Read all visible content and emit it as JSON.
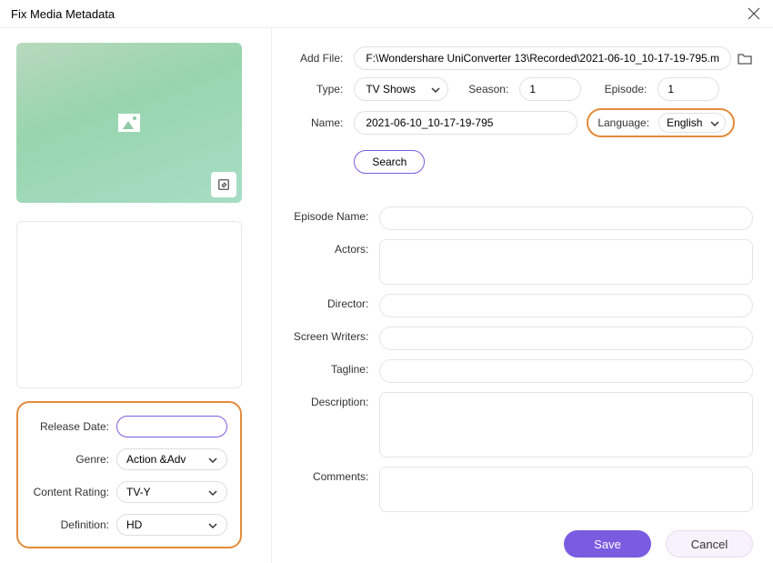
{
  "titlebar": {
    "title": "Fix Media Metadata"
  },
  "top": {
    "add_file_label": "Add File:",
    "add_file_value": "F:\\Wondershare UniConverter 13\\Recorded\\2021-06-10_10-17-19-795.m",
    "type_label": "Type:",
    "type_value": "TV Shows",
    "season_label": "Season:",
    "season_value": "1",
    "episode_label": "Episode:",
    "episode_value": "1",
    "name_label": "Name:",
    "name_value": "2021-06-10_10-17-19-795",
    "language_label": "Language:",
    "language_value": "English",
    "search_label": "Search"
  },
  "details": {
    "episode_name_label": "Episode Name:",
    "episode_name_value": "",
    "actors_label": "Actors:",
    "actors_value": "",
    "director_label": "Director:",
    "director_value": "",
    "screen_writers_label": "Screen Writers:",
    "screen_writers_value": "",
    "tagline_label": "Tagline:",
    "tagline_value": "",
    "description_label": "Description:",
    "description_value": "",
    "comments_label": "Comments:",
    "comments_value": ""
  },
  "left_meta": {
    "release_date_label": "Release Date:",
    "release_date_value": "",
    "genre_label": "Genre:",
    "genre_value": "Action &Adv",
    "content_rating_label": "Content Rating:",
    "content_rating_value": "TV-Y",
    "definition_label": "Definition:",
    "definition_value": "HD"
  },
  "footer": {
    "save_label": "Save",
    "cancel_label": "Cancel"
  }
}
